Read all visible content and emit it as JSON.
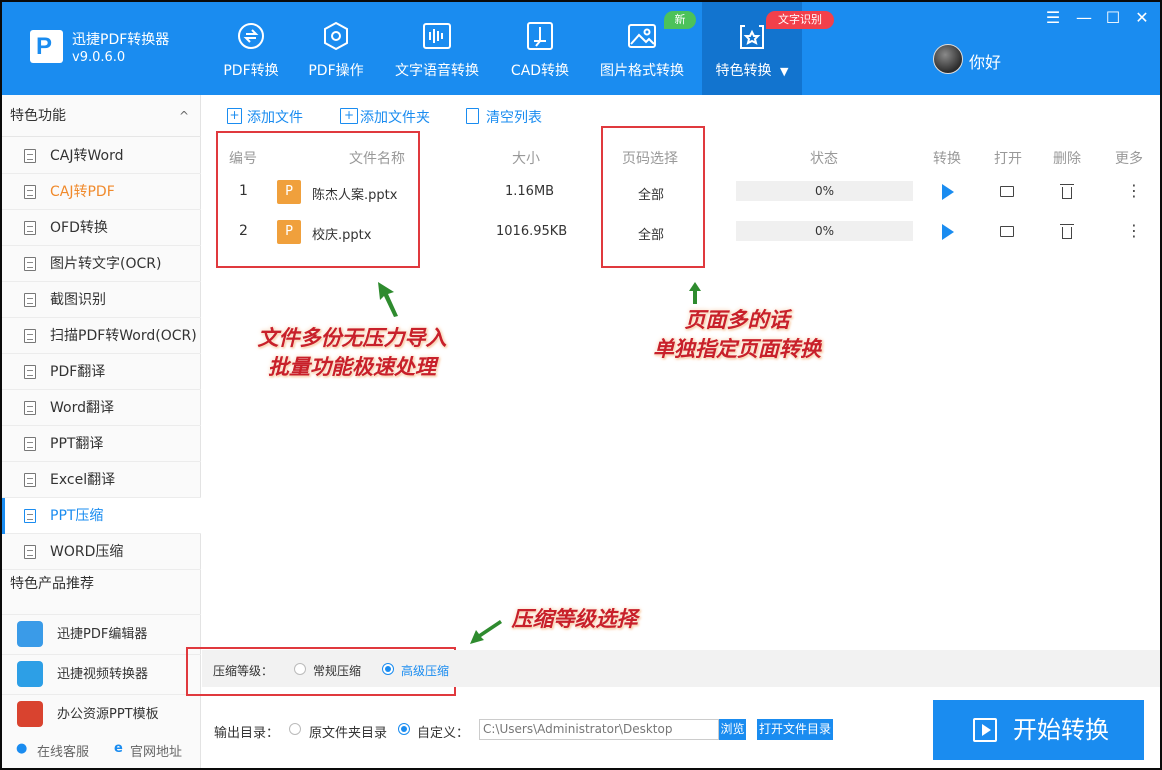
{
  "app": {
    "name": "迅捷PDF转换器",
    "version": "v9.0.6.0"
  },
  "nav": {
    "items": [
      {
        "label": "PDF转换",
        "icon": "pdf-convert-icon"
      },
      {
        "label": "PDF操作",
        "icon": "pdf-operate-icon"
      },
      {
        "label": "文字语音转换",
        "icon": "voice-wave-icon"
      },
      {
        "label": "CAD转换",
        "icon": "cad-icon"
      },
      {
        "label": "图片格式转换",
        "icon": "image-icon"
      },
      {
        "label": "特色转换",
        "icon": "special-convert-icon",
        "caret": "▼"
      }
    ],
    "badge_new": "新",
    "badge_ocr": "文字识别"
  },
  "user": {
    "name": "你好"
  },
  "window": {
    "menu": "☰",
    "minimize": "—",
    "maximize": "☐",
    "close": "✕"
  },
  "sidebar": {
    "section_title": "特色功能",
    "caret": "^",
    "items": [
      {
        "label": "CAJ转Word"
      },
      {
        "label": "CAJ转PDF"
      },
      {
        "label": "OFD转换"
      },
      {
        "label": "图片转文字(OCR)"
      },
      {
        "label": "截图识别"
      },
      {
        "label": "扫描PDF转Word(OCR)"
      },
      {
        "label": "PDF翻译"
      },
      {
        "label": "Word翻译"
      },
      {
        "label": "PPT翻译"
      },
      {
        "label": "Excel翻译"
      },
      {
        "label": "PPT压缩"
      },
      {
        "label": "WORD压缩"
      }
    ],
    "products_title": "特色产品推荐",
    "products": [
      {
        "label": "迅捷PDF编辑器",
        "color": "#3a9be8"
      },
      {
        "label": "迅捷视频转换器",
        "color": "#2d9fe6"
      },
      {
        "label": "办公资源PPT模板",
        "color": "#d9432f"
      }
    ],
    "footer": {
      "service": "在线客服",
      "website": "官网地址"
    }
  },
  "toolbar": {
    "add_file": "添加文件",
    "add_folder": "添加文件夹",
    "clear_list": "清空列表"
  },
  "table": {
    "headers": {
      "index": "编号",
      "filename": "文件名称",
      "size": "大小",
      "pages": "页码选择",
      "status": "状态",
      "convert": "转换",
      "open": "打开",
      "delete": "删除",
      "more": "更多"
    },
    "rows": [
      {
        "index": "1",
        "icon_letter": "P",
        "name": "陈杰人案.pptx",
        "size": "1.16MB",
        "pages": "全部",
        "progress": "0%"
      },
      {
        "index": "2",
        "icon_letter": "P",
        "name": "校庆.pptx",
        "size": "1016.95KB",
        "pages": "全部",
        "progress": "0%"
      }
    ]
  },
  "annotations": {
    "files_line1": "文件多份无压力导入",
    "files_line2": "批量功能极速处理",
    "pages_line1": "页面多的话",
    "pages_line2": "单独指定页面转换",
    "compress": "压缩等级选择"
  },
  "compress": {
    "label": "压缩等级：",
    "normal": "常规压缩",
    "advanced": "高级压缩",
    "selected": "advanced"
  },
  "output": {
    "label": "输出目录：",
    "original": "原文件夹目录",
    "custom": "自定义：",
    "path": "C:\\Users\\Administrator\\Desktop",
    "browse": "浏览",
    "open_dir": "打开文件目录"
  },
  "start_button": "开始转换",
  "colors": {
    "brand": "#1a8cf0",
    "annotation": "#c8202a",
    "highlight_box": "#e0393e",
    "orange": "#f08a2c"
  }
}
